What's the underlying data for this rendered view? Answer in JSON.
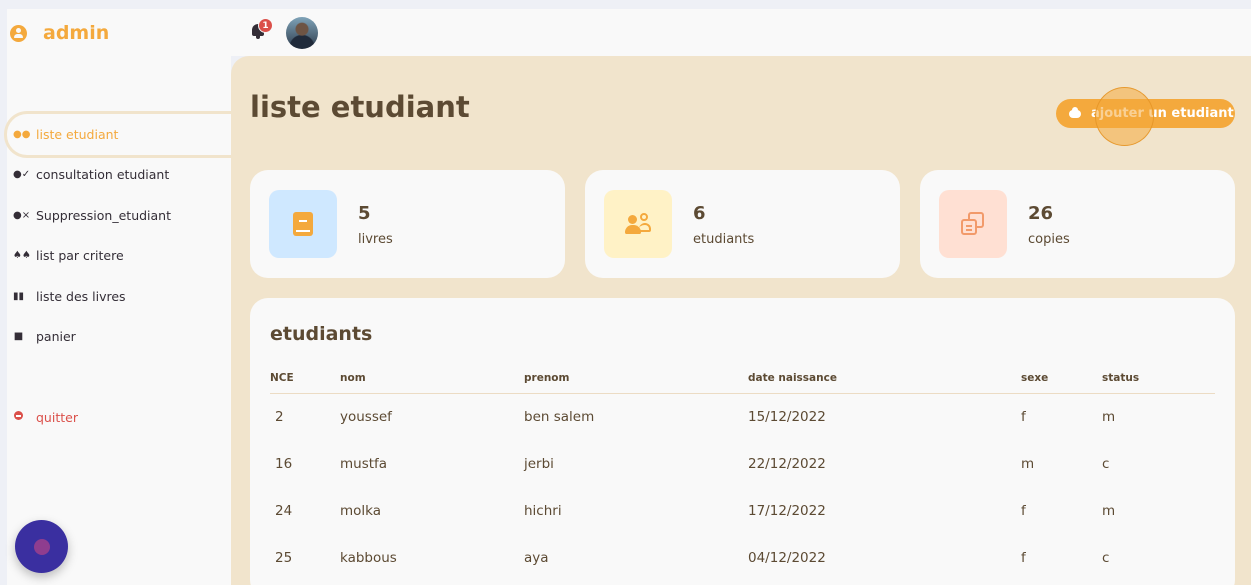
{
  "brand": {
    "title": "admin"
  },
  "sidebar": {
    "items": [
      {
        "label": "liste etudiant",
        "icon": "users-icon"
      },
      {
        "label": "consultation etudiant",
        "icon": "user-check-icon"
      },
      {
        "label": "Suppression_etudiant",
        "icon": "user-x-icon"
      },
      {
        "label": "list par critere",
        "icon": "people-icon"
      },
      {
        "label": "liste des livres",
        "icon": "books-icon"
      },
      {
        "label": "panier",
        "icon": "bag-icon"
      }
    ],
    "quit_label": "quitter"
  },
  "topnav": {
    "notifications_count": "1"
  },
  "main": {
    "title": "liste etudiant",
    "add_button": "ajouter un etudiant",
    "stats": [
      {
        "value": "5",
        "label": "livres",
        "icon": "book-icon"
      },
      {
        "value": "6",
        "label": "etudiants",
        "icon": "users-icon"
      },
      {
        "value": "26",
        "label": "copies",
        "icon": "copy-icon"
      }
    ],
    "table": {
      "title": "etudiants",
      "headers": [
        "NCE",
        "nom",
        "prenom",
        "date naissance",
        "sexe",
        "status"
      ],
      "rows": [
        [
          "2",
          "youssef",
          "ben salem",
          "15/12/2022",
          "f",
          "m"
        ],
        [
          "16",
          "mustfa",
          "jerbi",
          "22/12/2022",
          "m",
          "c"
        ],
        [
          "24",
          "molka",
          "hichri",
          "17/12/2022",
          "f",
          "m"
        ],
        [
          "25",
          "kabbous",
          "aya",
          "04/12/2022",
          "f",
          "c"
        ]
      ]
    }
  },
  "colors": {
    "accent": "#f4a93d",
    "danger": "#db504a",
    "main_bg": "#f1e4cc"
  }
}
